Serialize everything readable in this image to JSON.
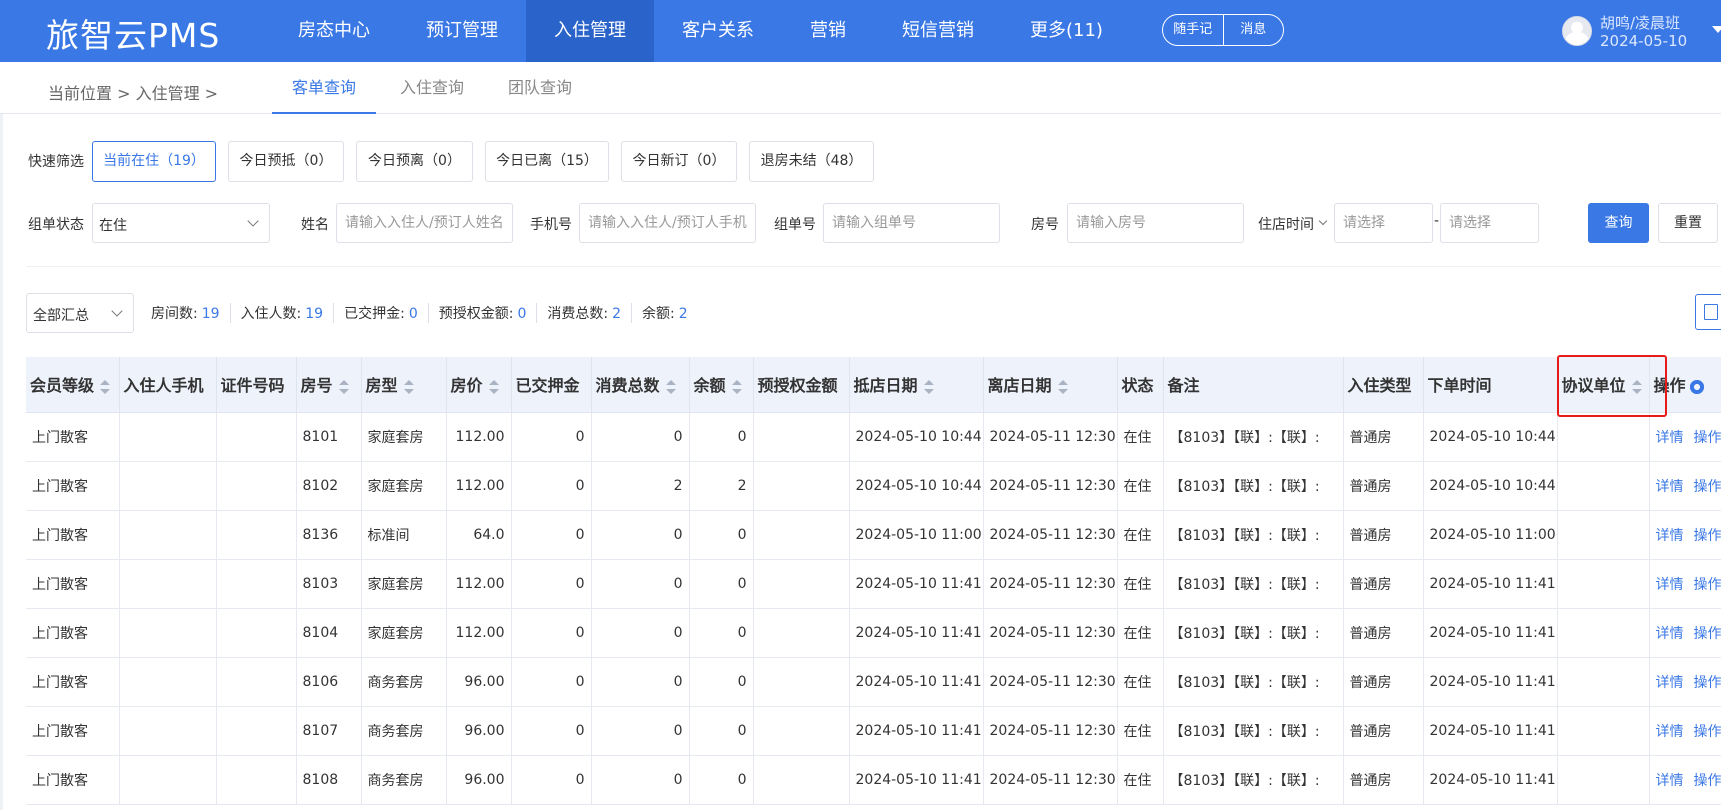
{
  "app": {
    "brand": "旅智云PMS"
  },
  "nav": {
    "items": [
      "房态中心",
      "预订管理",
      "入住管理",
      "客户关系",
      "营销",
      "短信营销",
      "更多(11)"
    ],
    "active_index": 2,
    "pill": [
      "随手记",
      "消息"
    ]
  },
  "user": {
    "name": "胡鸣/凌晨班",
    "date": "2024-05-10"
  },
  "subnav": {
    "breadcrumb": "当前位置 > 入住管理 >",
    "tabs": [
      "客单查询",
      "入住查询",
      "团队查询"
    ],
    "active_tab": 0
  },
  "quick_filter": {
    "label": "快速筛选",
    "buttons": [
      "当前在住（19）",
      "今日预抵（0）",
      "今日预离（0）",
      "今日已离（15）",
      "今日新订（0）",
      "退房未结（48）"
    ],
    "active_index": 0
  },
  "filters": {
    "group_status": {
      "label": "组单状态",
      "value": "在住"
    },
    "name": {
      "label": "姓名",
      "placeholder": "请输入入住人/预订人姓名"
    },
    "phone": {
      "label": "手机号",
      "placeholder": "请输入入住人/预订人手机号"
    },
    "group_no": {
      "label": "组单号",
      "placeholder": "请输入组单号"
    },
    "room": {
      "label": "房号",
      "placeholder": "请输入房号"
    },
    "stay_time": {
      "label": "住店时间",
      "start_placeholder": "请选择",
      "separator": "-",
      "end_placeholder": "请选择"
    },
    "search_label": "查询",
    "reset_label": "重置"
  },
  "summary": {
    "select_value": "全部汇总",
    "stats": [
      {
        "label": "房间数:",
        "value": "19"
      },
      {
        "label": "入住人数:",
        "value": "19"
      },
      {
        "label": "已交押金:",
        "value": "0"
      },
      {
        "label": "预授权金额:",
        "value": "0"
      },
      {
        "label": "消费总数:",
        "value": "2"
      },
      {
        "label": "余额:",
        "value": "2"
      }
    ]
  },
  "table": {
    "columns": [
      "会员等级",
      "入住人手机",
      "证件号码",
      "房号",
      "房型",
      "房价",
      "已交押金",
      "消费总数",
      "余额",
      "预授权金额",
      "抵店日期",
      "离店日期",
      "状态",
      "备注",
      "入住类型",
      "下单时间",
      "协议单位",
      "操作"
    ],
    "rows": [
      [
        "上门散客",
        "",
        "",
        "8101",
        "家庭套房",
        "112.00",
        "0",
        "0",
        "0",
        "",
        "2024-05-10 10:44",
        "2024-05-11 12:30",
        "在住",
        "【8103】【联】:【联】:",
        "普通房",
        "2024-05-10 10:44",
        "",
        ""
      ],
      [
        "上门散客",
        "",
        "",
        "8102",
        "家庭套房",
        "112.00",
        "0",
        "2",
        "2",
        "",
        "2024-05-10 10:44",
        "2024-05-11 12:30",
        "在住",
        "【8103】【联】:【联】:",
        "普通房",
        "2024-05-10 10:44",
        "",
        ""
      ],
      [
        "上门散客",
        "",
        "",
        "8136",
        "标准间",
        "64.0",
        "0",
        "0",
        "0",
        "",
        "2024-05-10 11:00",
        "2024-05-11 12:30",
        "在住",
        "【8103】【联】:【联】:",
        "普通房",
        "2024-05-10 11:00",
        "",
        ""
      ],
      [
        "上门散客",
        "",
        "",
        "8103",
        "家庭套房",
        "112.00",
        "0",
        "0",
        "0",
        "",
        "2024-05-10 11:41",
        "2024-05-11 12:30",
        "在住",
        "【8103】【联】:【联】:",
        "普通房",
        "2024-05-10 11:41",
        "",
        ""
      ],
      [
        "上门散客",
        "",
        "",
        "8104",
        "家庭套房",
        "112.00",
        "0",
        "0",
        "0",
        "",
        "2024-05-10 11:41",
        "2024-05-11 12:30",
        "在住",
        "【8103】【联】:【联】:",
        "普通房",
        "2024-05-10 11:41",
        "",
        ""
      ],
      [
        "上门散客",
        "",
        "",
        "8106",
        "商务套房",
        "96.00",
        "0",
        "0",
        "0",
        "",
        "2024-05-10 11:41",
        "2024-05-11 12:30",
        "在住",
        "【8103】【联】:【联】:",
        "普通房",
        "2024-05-10 11:41",
        "",
        ""
      ],
      [
        "上门散客",
        "",
        "",
        "8107",
        "商务套房",
        "96.00",
        "0",
        "0",
        "0",
        "",
        "2024-05-10 11:41",
        "2024-05-11 12:30",
        "在住",
        "【8103】【联】:【联】:",
        "普通房",
        "2024-05-10 11:41",
        "",
        ""
      ],
      [
        "上门散客",
        "",
        "",
        "8108",
        "商务套房",
        "96.00",
        "0",
        "0",
        "0",
        "",
        "2024-05-10 11:41",
        "2024-05-11 12:30",
        "在住",
        "【8103】【联】:【联】:",
        "普通房",
        "2024-05-10 11:41",
        "",
        ""
      ]
    ],
    "action_links": [
      "详情",
      "操作"
    ]
  },
  "colors": {
    "primary": "#3a78e6",
    "nav_bg": "#3a78e6",
    "highlight": "#e81a1a"
  },
  "icons": [
    "avatar-icon",
    "caret-down-icon",
    "chevron-down-icon",
    "sort-icon",
    "gear-icon",
    "export-icon"
  ]
}
